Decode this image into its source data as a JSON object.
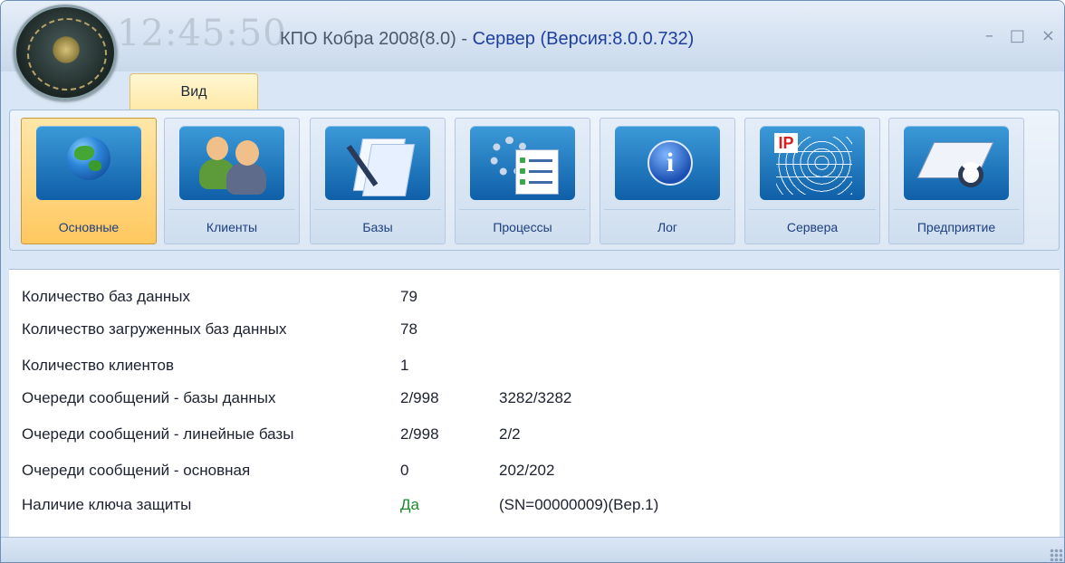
{
  "window": {
    "clock": "12:45:50",
    "title_app": "КПО Кобра 2008(8.0)",
    "title_sep": " - ",
    "title_server": "Сервер (Версия:8.0.0.732)",
    "controls": {
      "minimize": "–",
      "maximize": "□",
      "close": "×"
    }
  },
  "tabs": [
    {
      "label": "Вид"
    }
  ],
  "ribbon": {
    "buttons": [
      {
        "label": "Основные",
        "icon": "globe-icon",
        "active": true
      },
      {
        "label": "Клиенты",
        "icon": "users-icon"
      },
      {
        "label": "Базы",
        "icon": "documents-icon"
      },
      {
        "label": "Процессы",
        "icon": "processes-icon"
      },
      {
        "label": "Лог",
        "icon": "info-icon"
      },
      {
        "label": "Сервера",
        "icon": "ip-network-icon"
      },
      {
        "label": "Предприятие",
        "icon": "enterprise-icon"
      }
    ],
    "ip_badge": "IP",
    "info_glyph": "i"
  },
  "stats": [
    {
      "label": "Количество баз данных",
      "value": "79",
      "extra": ""
    },
    {
      "label": "Количество загруженных баз данных",
      "value": "78",
      "extra": ""
    },
    {
      "label": "Количество клиентов",
      "value": "1",
      "extra": ""
    },
    {
      "label": "Очереди сообщений - базы данных",
      "value": "2/998",
      "extra": "3282/3282"
    },
    {
      "label": "Очереди сообщений - линейные базы",
      "value": "2/998",
      "extra": "2/2"
    },
    {
      "label": "Очереди сообщений - основная",
      "value": "0",
      "extra": "202/202"
    },
    {
      "label": "Наличие ключа защиты",
      "value": "Да",
      "extra": "(SN=00000009)(Вер.1)"
    }
  ],
  "colors": {
    "accent": "#1f3f9f",
    "ok_green": "#1f8a2a",
    "active_tab": "#ffc860"
  }
}
